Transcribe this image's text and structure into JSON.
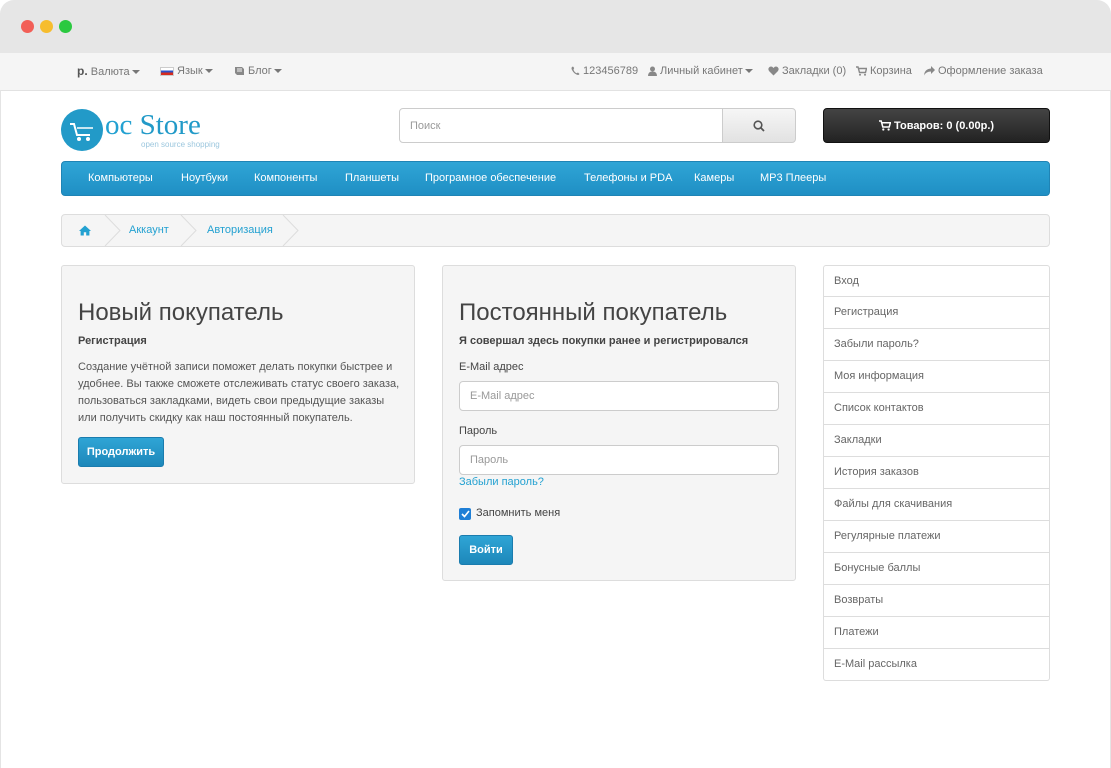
{
  "topbar": {
    "currency_symbol": "р.",
    "currency_label": "Валюта",
    "language_label": "Язык",
    "blog_label": "Блог",
    "phone": "123456789",
    "account_label": "Личный кабинет",
    "wishlist_label": "Закладки (0)",
    "cart_label": "Корзина",
    "checkout_label": "Оформление заказа"
  },
  "logo": {
    "oc": "oc",
    "store": "Store",
    "subtitle": "open source shopping"
  },
  "search": {
    "placeholder": "Поиск"
  },
  "cart_button": {
    "label": "Товаров: 0 (0.00р.)"
  },
  "menu": {
    "items": [
      "Компьютеры",
      "Ноутбуки",
      "Компоненты",
      "Планшеты",
      "Програмное обеспечение",
      "Телефоны и PDA",
      "Камеры",
      "MP3 Плееры"
    ]
  },
  "breadcrumb": {
    "items": [
      "Аккаунт",
      "Авторизация"
    ]
  },
  "new_customer": {
    "title": "Новый покупатель",
    "subtitle": "Регистрация",
    "text_lines": [
      "Создание учётной записи поможет делать покупки быстрее и",
      "удобнее. Вы также сможете отслеживать статус своего заказа,",
      "пользоваться закладками, видеть свои предыдущие заказы",
      "или получить скидку как наш постоянный покупатель."
    ],
    "button": "Продолжить"
  },
  "returning_customer": {
    "title": "Постоянный покупатель",
    "subtitle": "Я совершал здесь покупки ранее и регистрировался",
    "email_label": "E-Mail адрес",
    "email_placeholder": "E-Mail адрес",
    "password_label": "Пароль",
    "password_placeholder": "Пароль",
    "forgot_link": "Забыли пароль?",
    "remember_label": "Запомнить меня",
    "remember_checked": true,
    "login_button": "Войти"
  },
  "account_list": {
    "items": [
      "Вход",
      "Регистрация",
      "Забыли пароль?",
      "Моя информация",
      "Список контактов",
      "Закладки",
      "История заказов",
      "Файлы для скачивания",
      "Регулярные платежи",
      "Бонусные баллы",
      "Возвраты",
      "Платежи",
      "E-Mail рассылка"
    ]
  },
  "colors": {
    "brand": "#229ac8",
    "menu": "#2399cf",
    "cart_button": "#333333"
  }
}
